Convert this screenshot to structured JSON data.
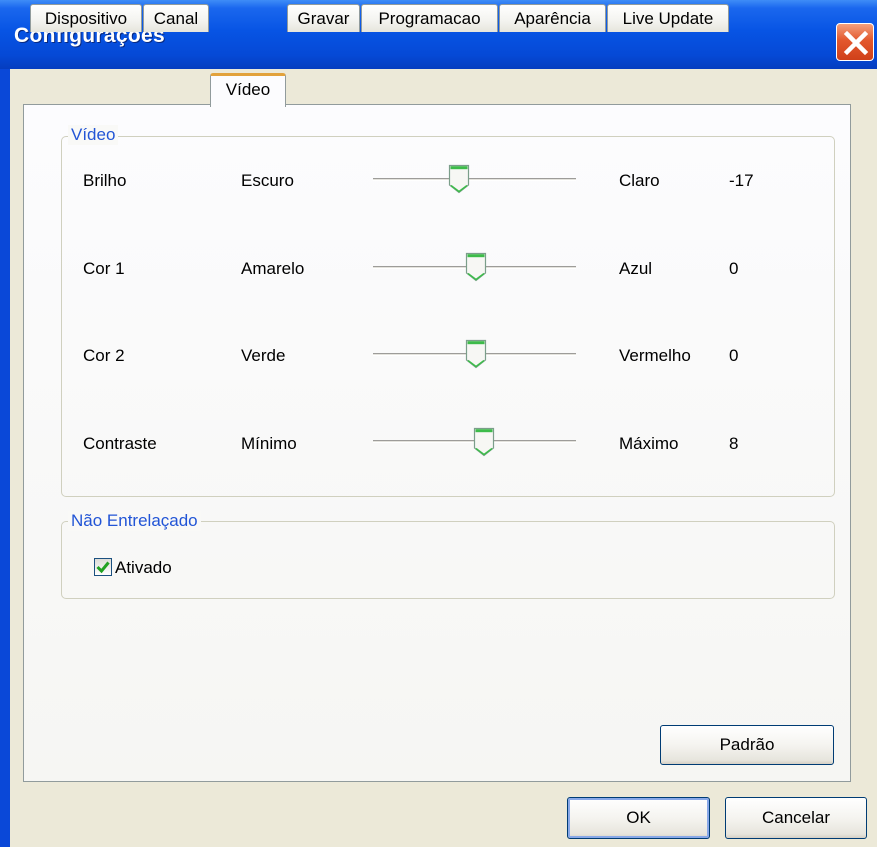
{
  "window": {
    "title": "Configurações"
  },
  "tabs": [
    "Dispositivo",
    "Canal",
    "Vídeo",
    "Gravar",
    "Programacao",
    "Aparência",
    "Live Update"
  ],
  "active_tab": "Vídeo",
  "video_group": {
    "label": "Vídeo",
    "sliders": [
      {
        "name": "Brilho",
        "min_label": "Escuro",
        "max_label": "Claro",
        "value": "-17"
      },
      {
        "name": "Cor 1",
        "min_label": "Amarelo",
        "max_label": "Azul",
        "value": "0"
      },
      {
        "name": "Cor 2",
        "min_label": "Verde",
        "max_label": "Vermelho",
        "value": "0"
      },
      {
        "name": "Contraste",
        "min_label": "Mínimo",
        "max_label": "Máximo",
        "value": "8"
      }
    ]
  },
  "deinterlace_group": {
    "label": "Não Entrelaçado",
    "checkbox_label": "Ativado",
    "checked": true
  },
  "buttons": {
    "default": "Padrão",
    "ok": "OK",
    "cancel": "Cancelar"
  },
  "colors": {
    "title_bar": "#0754e4",
    "accent_label": "#2255d6",
    "dialog_bg": "#ece9d8",
    "thumb_green": "#3dbb4a",
    "check_green": "#21a121"
  }
}
